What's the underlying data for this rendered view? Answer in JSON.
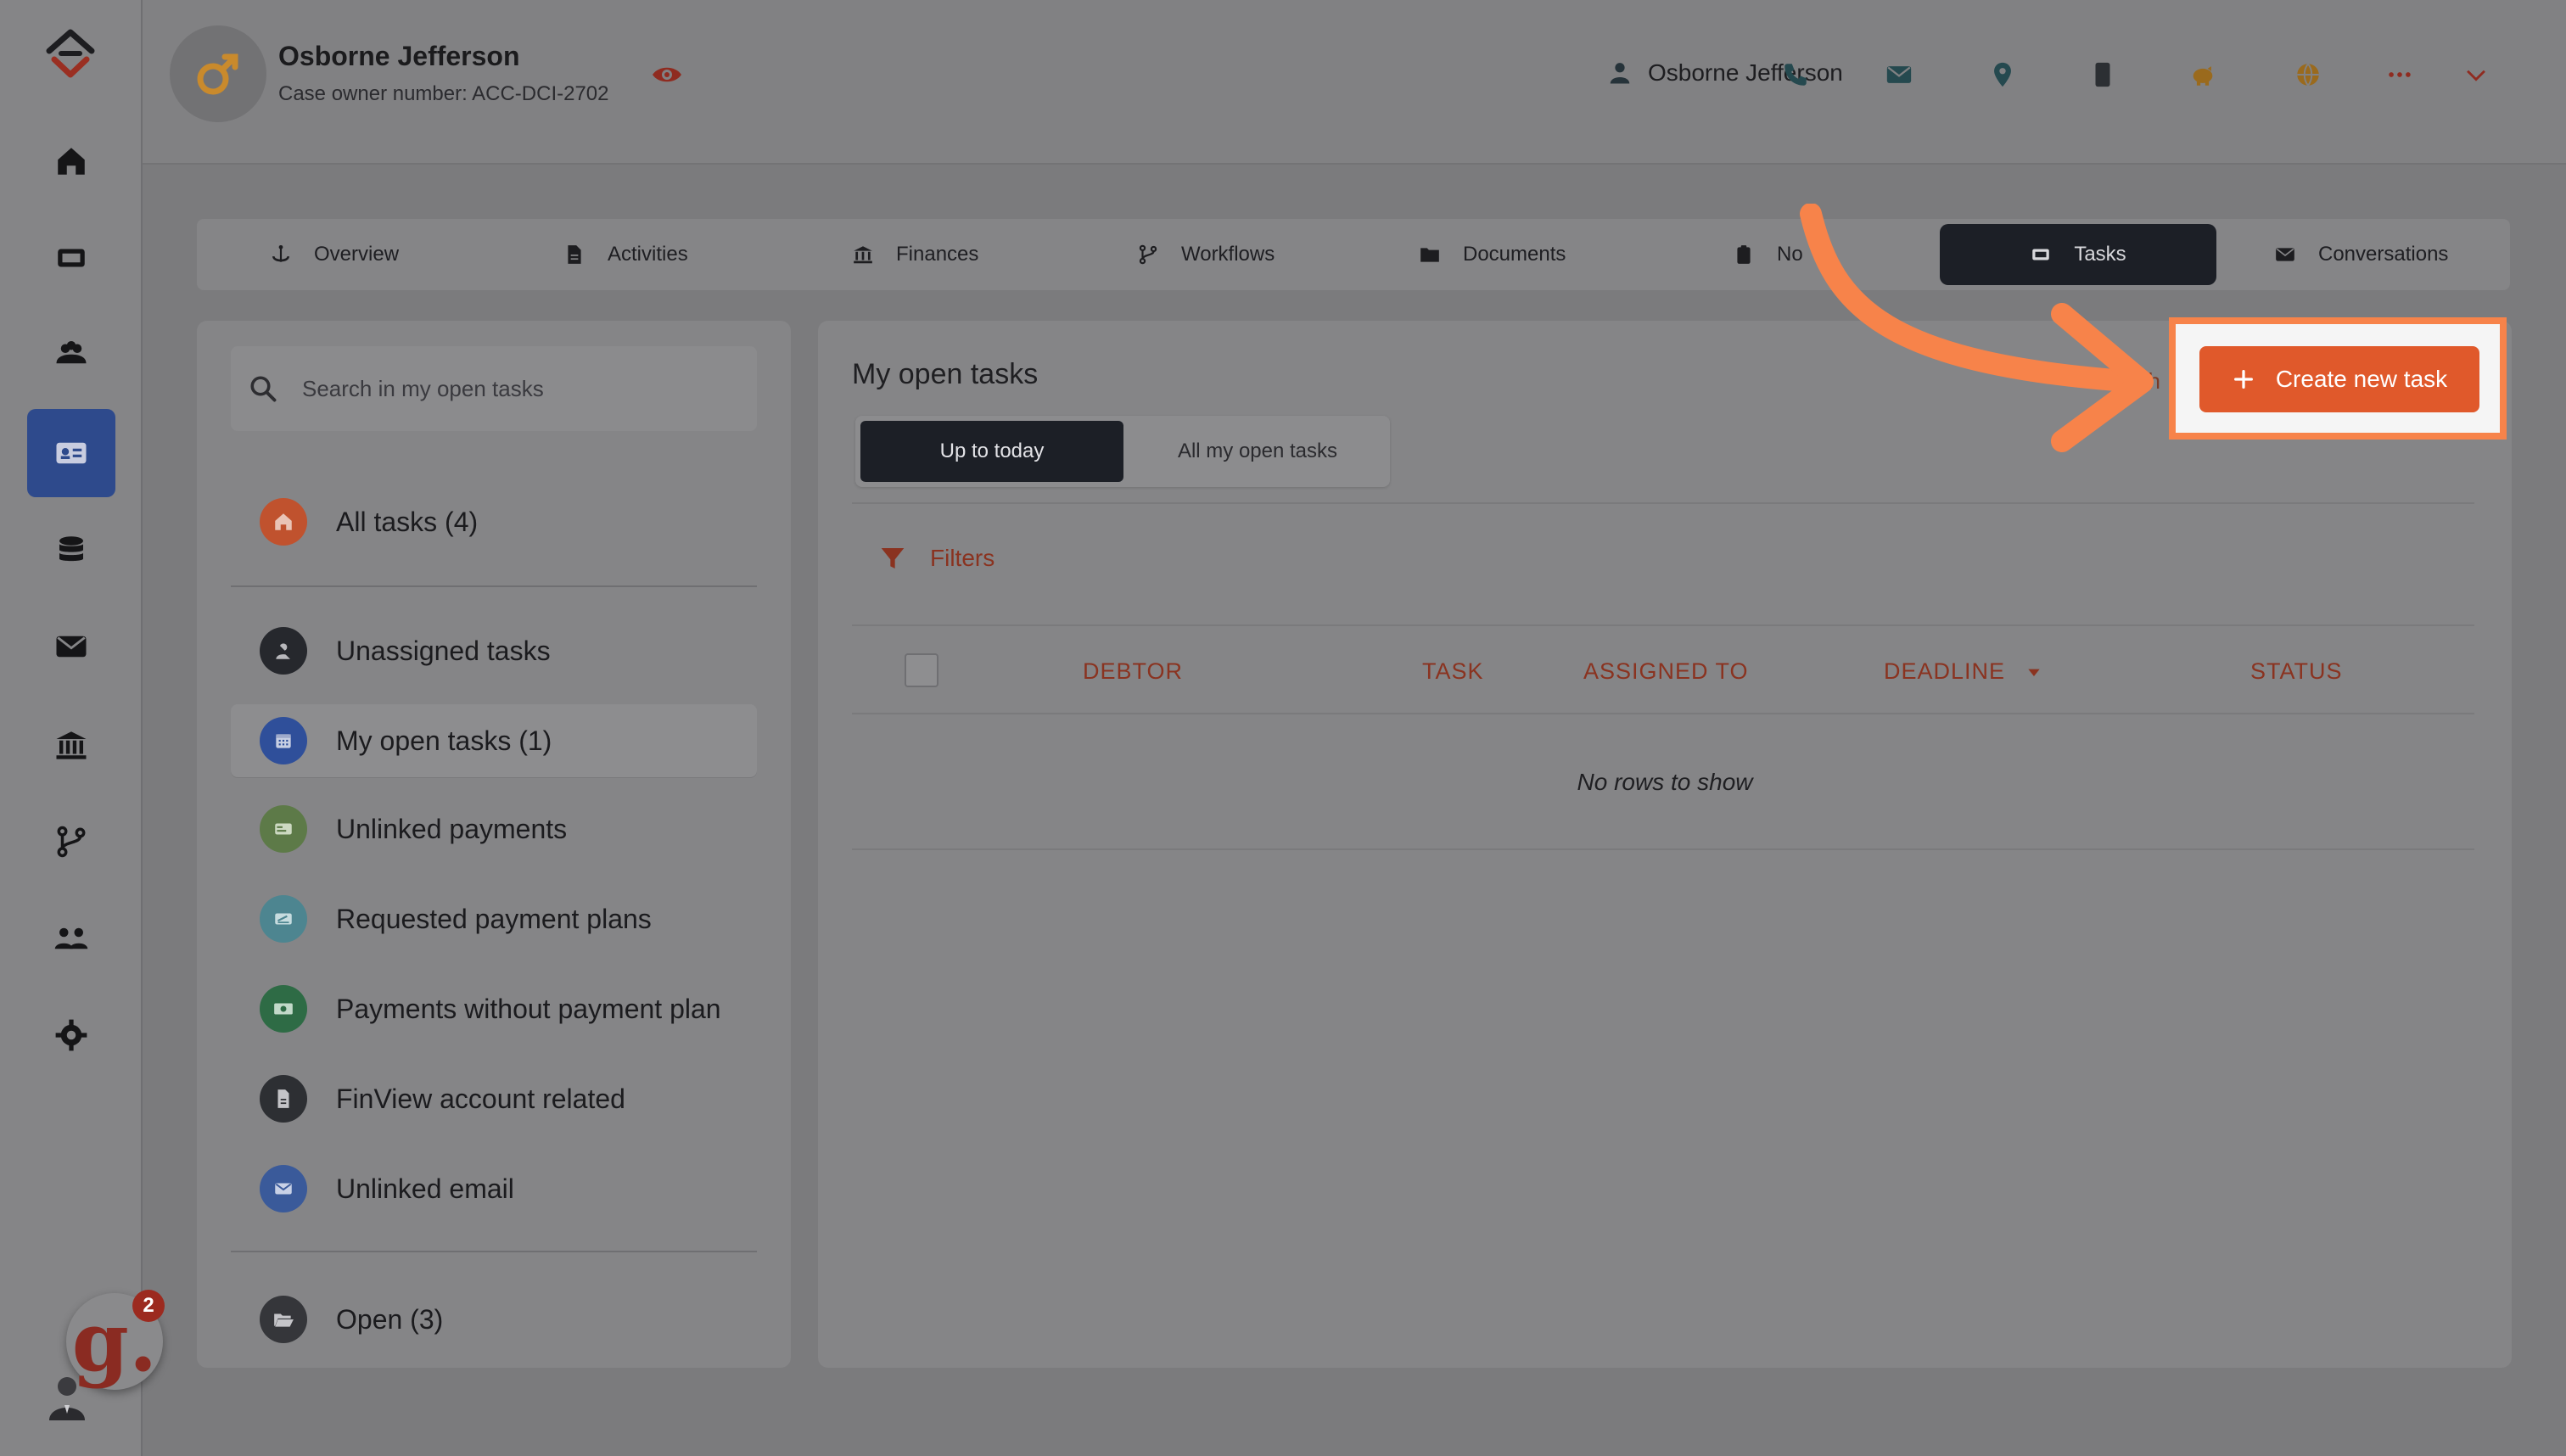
{
  "nav": {
    "items": [
      {
        "name": "home-icon"
      },
      {
        "name": "ticket-icon"
      },
      {
        "name": "users-icon"
      },
      {
        "name": "id-card-icon",
        "active": true
      },
      {
        "name": "database-icon"
      },
      {
        "name": "envelope-icon"
      },
      {
        "name": "bank-icon"
      },
      {
        "name": "branch-icon"
      },
      {
        "name": "team-icon"
      },
      {
        "name": "gear-icon"
      }
    ],
    "assistant_badge": {
      "letter": "g.",
      "count": "2"
    }
  },
  "header": {
    "case_name": "Osborne Jefferson",
    "case_owner": "Case owner number: ACC-DCI-2702",
    "contact_name": "Osborne Jefferson",
    "icons": [
      "phone-icon",
      "mail-icon",
      "location-icon",
      "mobile-icon",
      "piggy-bank-icon",
      "globe-icon",
      "more-icon",
      "chevron-down-icon"
    ]
  },
  "tabs": [
    {
      "label": "Overview"
    },
    {
      "label": "Activities"
    },
    {
      "label": "Finances"
    },
    {
      "label": "Workflows"
    },
    {
      "label": "Documents"
    },
    {
      "label": "No"
    },
    {
      "label": "Tasks",
      "active": true
    },
    {
      "label": "Conversations"
    }
  ],
  "left_panel": {
    "search_placeholder": "Search in my open tasks",
    "items": [
      {
        "label": "All tasks (4)",
        "color": "#c0522e"
      },
      {
        "label": "Unassigned tasks",
        "color": "#26282d"
      },
      {
        "label": "My open tasks (1)",
        "color": "#2f4f9a",
        "selected": true
      },
      {
        "label": "Unlinked payments",
        "color": "#5d7a48"
      },
      {
        "label": "Requested payment plans",
        "color": "#4d8590"
      },
      {
        "label": "Payments without payment plan",
        "color": "#2e6b45"
      },
      {
        "label": "FinView account related",
        "color": "#2d2f33"
      },
      {
        "label": "Unlinked email",
        "color": "#3a5a9a"
      },
      {
        "label": "Open (3)",
        "color": "#35363a"
      }
    ]
  },
  "main": {
    "title": "My open tasks",
    "refresh_fragment": "esh",
    "segments": [
      {
        "label": "Up to today",
        "active": true
      },
      {
        "label": "All my open tasks"
      }
    ],
    "filters_label": "Filters",
    "columns": [
      "DEBTOR",
      "TASK",
      "ASSIGNED TO",
      "DEADLINE",
      "STATUS"
    ],
    "empty_message": "No rows to show",
    "create_button": "Create new task"
  },
  "colors": {
    "accent": "#e0592b",
    "highlight": "#f7834a",
    "dark": "#1c1f26"
  }
}
